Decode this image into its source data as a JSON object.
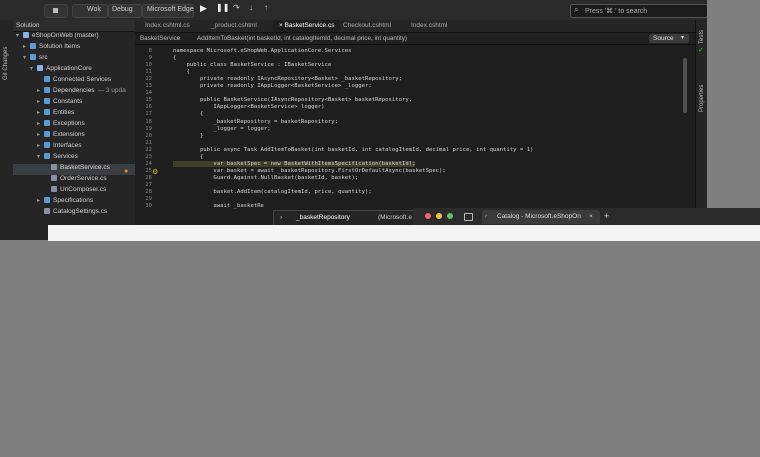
{
  "toolbar": {
    "config": "Woḳ",
    "debug": "Debug",
    "browser": "Microsoft Edge",
    "search_placeholder": "Press '⌘.' to search",
    "play_icon": "play-icon",
    "pause_icon": "pause-icon"
  },
  "left_strip": {
    "label": "Git Changes"
  },
  "right_strip": {
    "tests": "Tests",
    "properties": "Properties"
  },
  "solution": {
    "header": "Solution",
    "items": [
      {
        "label": "eShopOnWeb (master)",
        "indent": 0,
        "arrow": "▾",
        "icon": "solution"
      },
      {
        "label": "Solution Items",
        "indent": 1,
        "arrow": "▸",
        "icon": "folder"
      },
      {
        "label": "src",
        "indent": 1,
        "arrow": "▾",
        "icon": "folder"
      },
      {
        "label": "ApplicationCore",
        "indent": 2,
        "arrow": "▾",
        "icon": "project"
      },
      {
        "label": "Connected Services",
        "indent": 3,
        "arrow": "",
        "icon": "folder"
      },
      {
        "label": "Dependencies",
        "indent": 3,
        "arrow": "▸",
        "icon": "folder",
        "badge": "— 3 upda"
      },
      {
        "label": "Constants",
        "indent": 3,
        "arrow": "▸",
        "icon": "folder"
      },
      {
        "label": "Entities",
        "indent": 3,
        "arrow": "▸",
        "icon": "folder"
      },
      {
        "label": "Exceptions",
        "indent": 3,
        "arrow": "▸",
        "icon": "folder"
      },
      {
        "label": "Extensions",
        "indent": 3,
        "arrow": "▸",
        "icon": "folder"
      },
      {
        "label": "Interfaces",
        "indent": 3,
        "arrow": "▸",
        "icon": "folder"
      },
      {
        "label": "Services",
        "indent": 3,
        "arrow": "▾",
        "icon": "folder"
      },
      {
        "label": "BasketService.cs",
        "indent": 4,
        "arrow": "",
        "icon": "cs",
        "selected": true
      },
      {
        "label": "OrderService.cs",
        "indent": 4,
        "arrow": "",
        "icon": "cs"
      },
      {
        "label": "UriComposer.cs",
        "indent": 4,
        "arrow": "",
        "icon": "cs"
      },
      {
        "label": "Specifications",
        "indent": 3,
        "arrow": "▸",
        "icon": "folder"
      },
      {
        "label": "CatalogSettings.cs",
        "indent": 3,
        "arrow": "",
        "icon": "cs"
      }
    ]
  },
  "tabs": [
    {
      "label": "Index.cshtml.cs",
      "active": false
    },
    {
      "label": "_product.cshtml",
      "active": false
    },
    {
      "label": "× BasketService.cs",
      "active": true
    },
    {
      "label": "Checkout.cshtml",
      "active": false
    },
    {
      "label": "Index.cshtml",
      "active": false
    }
  ],
  "breadcrumb": {
    "class": "BasketService",
    "method": "AddItemToBasket(int basketId, int catalogItemId, decimal price, int quantity)",
    "source": "Source"
  },
  "code": [
    {
      "n": "8",
      "t": "namespace Microsoft.eShopWeb.ApplicationCore.Services"
    },
    {
      "n": "9",
      "t": "{"
    },
    {
      "n": "10",
      "t": "    public class BasketService : IBasketService"
    },
    {
      "n": "11",
      "t": "    {"
    },
    {
      "n": "12",
      "t": "        private readonly IAsyncRepository<Basket> _basketRepository;"
    },
    {
      "n": "13",
      "t": "        private readonly IAppLogger<BasketService> _logger;"
    },
    {
      "n": "14",
      "t": ""
    },
    {
      "n": "15",
      "t": "        public BasketService(IAsyncRepository<Basket> basketRepository,"
    },
    {
      "n": "16",
      "t": "            IAppLogger<BasketService> logger)"
    },
    {
      "n": "17",
      "t": "        {"
    },
    {
      "n": "18",
      "t": "            _basketRepository = basketRepository;"
    },
    {
      "n": "19",
      "t": "            _logger = logger;"
    },
    {
      "n": "20",
      "t": "        }"
    },
    {
      "n": "21",
      "t": ""
    },
    {
      "n": "22",
      "t": "        public async Task AddItemToBasket(int basketId, int catalogItemId, decimal price, int quantity = 1)"
    },
    {
      "n": "23",
      "t": "        {"
    },
    {
      "n": "24",
      "t": "            var basketSpec = new BasketWithItemsSpecification(basketId);",
      "hl": true
    },
    {
      "n": "25",
      "t": "            var basket = await _basketRepository.FirstOrDefaultAsync(basketSpec);"
    },
    {
      "n": "26",
      "t": "            Guard.Against.NullBasket(basketId, basket);"
    },
    {
      "n": "27",
      "t": ""
    },
    {
      "n": "28",
      "t": "            basket.AddItem(catalogItemId, price, quantity);"
    },
    {
      "n": "29",
      "t": ""
    },
    {
      "n": "30",
      "t": "            await _basketRe"
    }
  ],
  "autocomplete": {
    "arrow": "›",
    "item": "_basketRepository",
    "detail": "(Microsoft.e"
  },
  "browser": {
    "tab_title": "Catalog - Microsoft.eShopOn",
    "close": "×",
    "new_tab": "+"
  },
  "colors": {
    "accent": "#3a8ee6",
    "editor_bg": "#1e1e1e",
    "backdrop": "#7f7f7f"
  }
}
